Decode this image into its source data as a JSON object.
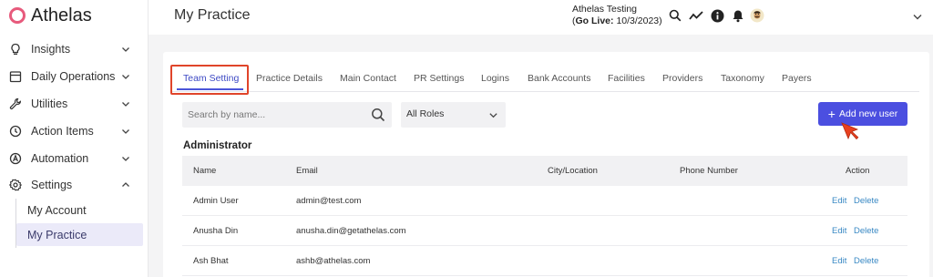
{
  "app": {
    "name": "Athelas"
  },
  "sidebar": {
    "items": [
      {
        "label": "Insights",
        "icon": "bulb-icon",
        "expanded": false
      },
      {
        "label": "Daily Operations",
        "icon": "calendar-icon",
        "expanded": false
      },
      {
        "label": "Utilities",
        "icon": "wrench-icon",
        "expanded": false
      },
      {
        "label": "Action Items",
        "icon": "clock-icon",
        "expanded": false
      },
      {
        "label": "Automation",
        "icon": "automation-icon",
        "expanded": false
      },
      {
        "label": "Settings",
        "icon": "gear-icon",
        "expanded": true
      }
    ],
    "subitems": [
      {
        "label": "My Account",
        "active": false
      },
      {
        "label": "My Practice",
        "active": true
      }
    ]
  },
  "header": {
    "title": "My Practice",
    "org_name": "Athelas Testing",
    "go_live_label": "Go Live:",
    "go_live_date": "10/3/2023"
  },
  "tabs": [
    {
      "label": "Team Setting",
      "active": true
    },
    {
      "label": "Practice Details"
    },
    {
      "label": "Main Contact"
    },
    {
      "label": "PR Settings"
    },
    {
      "label": "Logins"
    },
    {
      "label": "Bank Accounts"
    },
    {
      "label": "Facilities"
    },
    {
      "label": "Providers"
    },
    {
      "label": "Taxonomy"
    },
    {
      "label": "Payers"
    }
  ],
  "search": {
    "placeholder": "Search by name...",
    "value": ""
  },
  "role_filter": {
    "selected": "All Roles"
  },
  "add_button": {
    "label": "Add new user"
  },
  "section": {
    "title": "Administrator"
  },
  "table": {
    "columns": [
      "Name",
      "Email",
      "City/Location",
      "Phone Number",
      "Action"
    ],
    "rows": [
      {
        "name": "Admin User",
        "email": "admin@test.com",
        "city": "",
        "phone": ""
      },
      {
        "name": "Anusha Din",
        "email": "anusha.din@getathelas.com",
        "city": "",
        "phone": ""
      },
      {
        "name": "Ash Bhat",
        "email": "ashb@athelas.com",
        "city": "",
        "phone": ""
      }
    ],
    "actions": {
      "edit": "Edit",
      "delete": "Delete"
    }
  },
  "colors": {
    "accent": "#4b4fe0",
    "link": "#3a89c4",
    "highlight": "#e0442a",
    "logo": "#e75a7c"
  }
}
